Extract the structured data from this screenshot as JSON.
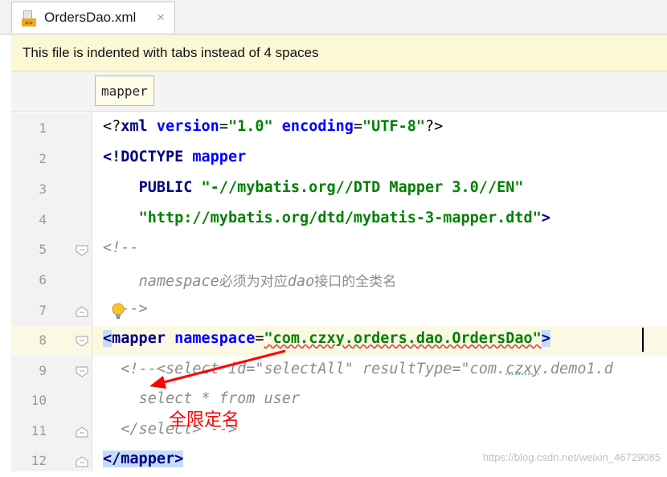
{
  "tab": {
    "filename": "OrdersDao.xml",
    "close_glyph": "×",
    "icon": "xml-file-icon"
  },
  "notice": {
    "text": "This file is indented with tabs instead of 4 spaces"
  },
  "breadcrumb": {
    "item": "mapper"
  },
  "lines": [
    {
      "num": "1"
    },
    {
      "num": "2"
    },
    {
      "num": "3"
    },
    {
      "num": "4"
    },
    {
      "num": "5"
    },
    {
      "num": "6"
    },
    {
      "num": "7"
    },
    {
      "num": "8"
    },
    {
      "num": "9"
    },
    {
      "num": "10"
    },
    {
      "num": "11"
    },
    {
      "num": "12"
    }
  ],
  "code": {
    "l1_open": "<?",
    "l1_tag": "xml",
    "l1_a1": "version",
    "l1_eq1": "=",
    "l1_v1": "\"1.0\"",
    "l1_a2": "encoding",
    "l1_eq2": "=",
    "l1_v2": "\"UTF-8\"",
    "l1_close": "?>",
    "l2_tag": "<!DOCTYPE",
    "l2_name": "mapper",
    "l3_public": "PUBLIC",
    "l3_v": "\"-//mybatis.org//DTD Mapper 3.0//EN\"",
    "l4_v": "\"http://mybatis.org/dtd/mybatis-3-mapper.dtd\"",
    "l4_close": ">",
    "l5": "<!--",
    "l6_word": "namespace",
    "l6_cn": "必须为对应",
    "l6_dao": "dao",
    "l6_cn2": "接口的全类名",
    "l7": "-->",
    "l8_open": "<",
    "l8_tag": "mapper",
    "l8_attr": "namespace",
    "l8_eq": "=",
    "l8_v": "\"com.czxy.orders.dao.OrdersDao\"",
    "l8_close": ">",
    "l9_a": "<!--<select id=\"selectAll\" resultType=\"com.",
    "l9_b": "czxy",
    "l9_c": ".demo1.d",
    "l10": "select * from user",
    "l11": "</select> -->",
    "l12_open": "</",
    "l12_tag": "mapper",
    "l12_close": ">"
  },
  "annotation": {
    "text": "全限定名",
    "color": "#ff0000"
  },
  "watermark": {
    "text": "https://blog.csdn.net/weixin_46729085"
  },
  "colors": {
    "tag": "#000080",
    "attr": "#0000ff",
    "value": "#008000",
    "comment": "#8c8c8c",
    "notice_bg": "#fcf8d6",
    "highlight": "#c6dcfb"
  }
}
